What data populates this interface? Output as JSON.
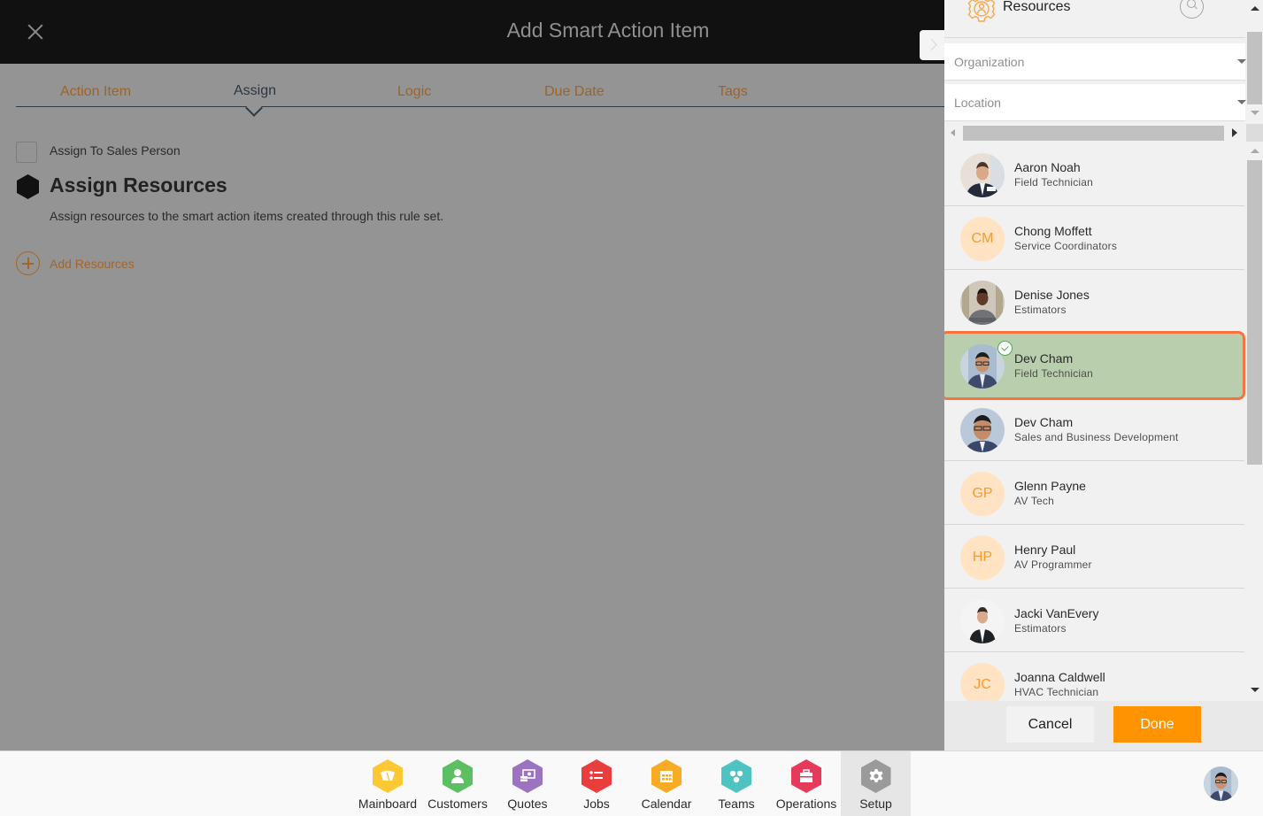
{
  "header": {
    "title": "Add Smart Action Item",
    "close_icon": "close-icon"
  },
  "tabs": [
    {
      "label": "Action Item",
      "active": false
    },
    {
      "label": "Assign",
      "active": true
    },
    {
      "label": "Logic",
      "active": false
    },
    {
      "label": "Due Date",
      "active": false
    },
    {
      "label": "Tags",
      "active": false
    }
  ],
  "assign": {
    "checkbox_label": "Assign To Sales Person",
    "checkbox_checked": false,
    "section_title": "Assign Resources",
    "section_description": "Assign resources to the smart action items created through this rule set.",
    "add_resources_label": "Add Resources"
  },
  "panel": {
    "title": "Resources",
    "icon": "resources-gear-icon",
    "search_icon": "search-icon",
    "filters": [
      {
        "label": "Organization",
        "value": ""
      },
      {
        "label": "Location",
        "value": ""
      }
    ],
    "resources": [
      {
        "name": "Aaron Noah",
        "role": "Field Technician",
        "avatar": "photo",
        "initials": "",
        "selected": false
      },
      {
        "name": "Chong Moffett",
        "role": "Service Coordinators",
        "avatar": "initials",
        "initials": "CM",
        "selected": false
      },
      {
        "name": "Denise Jones",
        "role": "Estimators",
        "avatar": "photo",
        "initials": "",
        "selected": false
      },
      {
        "name": "Dev Cham",
        "role": "Field Technician",
        "avatar": "photo",
        "initials": "",
        "selected": true
      },
      {
        "name": "Dev Cham",
        "role": "Sales and Business Development",
        "avatar": "photo",
        "initials": "",
        "selected": false
      },
      {
        "name": "Glenn Payne",
        "role": "AV Tech",
        "avatar": "initials",
        "initials": "GP",
        "selected": false
      },
      {
        "name": "Henry Paul",
        "role": "AV Programmer",
        "avatar": "initials",
        "initials": "HP",
        "selected": false
      },
      {
        "name": "Jacki VanEvery",
        "role": "Estimators",
        "avatar": "photo",
        "initials": "",
        "selected": false
      },
      {
        "name": "Joanna Caldwell",
        "role": "HVAC Technician",
        "avatar": "initials",
        "initials": "JC",
        "selected": false
      }
    ],
    "cancel_label": "Cancel",
    "done_label": "Done"
  },
  "bottom_nav": [
    {
      "label": "Mainboard",
      "icon": "mainboard-icon",
      "color": "#fcc934",
      "active": false
    },
    {
      "label": "Customers",
      "icon": "customers-icon",
      "color": "#5cbf62",
      "active": false
    },
    {
      "label": "Quotes",
      "icon": "quotes-icon",
      "color": "#9c73c1",
      "active": false
    },
    {
      "label": "Jobs",
      "icon": "jobs-icon",
      "color": "#ea3e3c",
      "active": false
    },
    {
      "label": "Calendar",
      "icon": "calendar-icon",
      "color": "#f8ac25",
      "active": false
    },
    {
      "label": "Teams",
      "icon": "teams-icon",
      "color": "#4fc3c2",
      "active": false
    },
    {
      "label": "Operations",
      "icon": "operations-icon",
      "color": "#e63a5a",
      "active": false
    },
    {
      "label": "Setup",
      "icon": "setup-gear-icon",
      "color": "#9a9a9a",
      "active": true
    }
  ],
  "colors": {
    "accent": "#ff9300",
    "tab_inactive": "#9c6428",
    "selected_row": "#b8cead",
    "selected_border": "#f5743d"
  }
}
